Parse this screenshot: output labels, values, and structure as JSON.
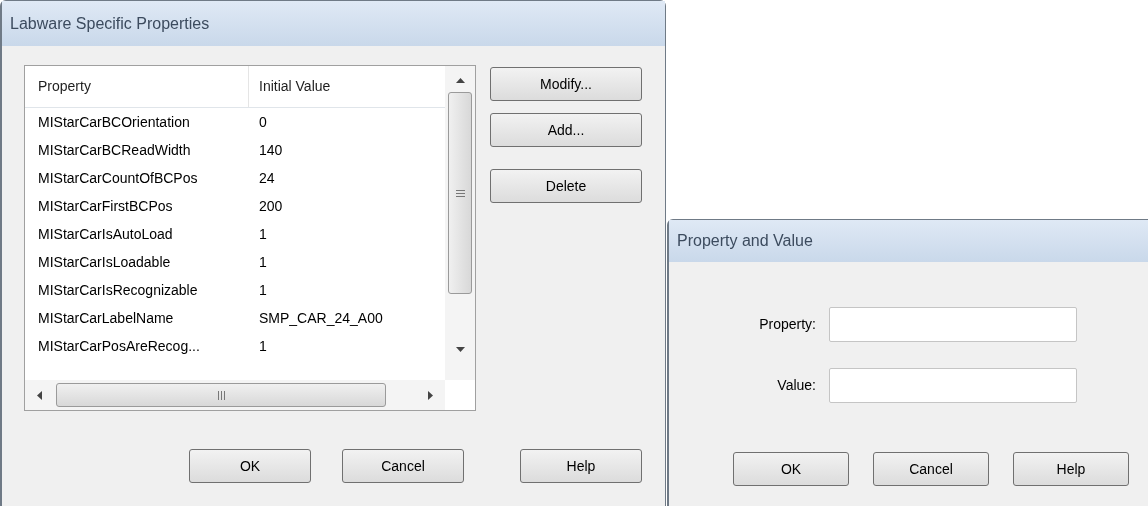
{
  "dialogs": [
    {
      "kind": "list",
      "title": "Labware Specific Properties",
      "table": {
        "columns": [
          "Property",
          "Initial Value"
        ],
        "rows": [
          {
            "property": "MIStarCarBCOrientation",
            "value": "0"
          },
          {
            "property": "MIStarCarBCReadWidth",
            "value": "140"
          },
          {
            "property": "MIStarCarCountOfBCPos",
            "value": "24"
          },
          {
            "property": "MIStarCarFirstBCPos",
            "value": "200"
          },
          {
            "property": "MIStarCarIsAutoLoad",
            "value": "1"
          },
          {
            "property": "MIStarCarIsLoadable",
            "value": "1"
          },
          {
            "property": "MIStarCarIsRecognizable",
            "value": "1"
          },
          {
            "property": "MIStarCarLabelName",
            "value": "SMP_CAR_24_A00"
          },
          {
            "property": "MIStarCarPosAreRecog...",
            "value": "1"
          }
        ]
      },
      "side_buttons": [
        "Modify...",
        "Add...",
        "Delete"
      ],
      "buttons": [
        "OK",
        "Cancel",
        "Help"
      ]
    },
    {
      "kind": "form",
      "title": "Property and Value",
      "fields": [
        {
          "label": "Property:"
        },
        {
          "label": "Value:"
        }
      ],
      "buttons": [
        "OK",
        "Cancel",
        "Help"
      ]
    }
  ]
}
